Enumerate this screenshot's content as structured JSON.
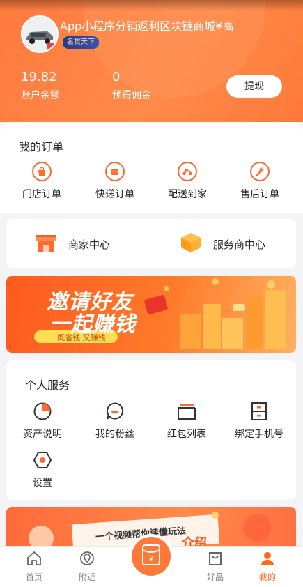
{
  "header": {
    "username": "App小程序分销返利区块链商城¥高",
    "badge": "名贯天下",
    "stats": [
      {
        "value": "19.82",
        "label": "账户余额"
      },
      {
        "value": "0",
        "label": "预得佣金"
      }
    ],
    "withdraw_label": "提现"
  },
  "orders": {
    "title": "我的订单",
    "items": [
      {
        "label": "门店订单",
        "icon": "shopping-bag-icon"
      },
      {
        "label": "快递订单",
        "icon": "package-icon"
      },
      {
        "label": "配送到家",
        "icon": "scooter-icon"
      },
      {
        "label": "售后订单",
        "icon": "wrench-icon"
      }
    ]
  },
  "centers": [
    {
      "label": "商家中心",
      "icon": "storefront-icon"
    },
    {
      "label": "服务商中心",
      "icon": "box-3d-icon"
    }
  ],
  "invite_banner": {
    "line1": "邀请好友",
    "line2": "一起赚钱",
    "tag": "既省钱 又赚钱"
  },
  "services": {
    "title": "个人服务",
    "items": [
      {
        "label": "资产说明",
        "icon": "pie-chart-icon"
      },
      {
        "label": "我的粉丝",
        "icon": "smile-chat-icon"
      },
      {
        "label": "红包列表",
        "icon": "red-packet-icon"
      },
      {
        "label": "绑定手机号",
        "icon": "cabinet-icon"
      },
      {
        "label": "设置",
        "icon": "settings-hexagon-icon"
      }
    ]
  },
  "bottom_banner": {
    "text": "一个视频帮你读懂玩法",
    "tail": "介绍"
  },
  "tabbar": {
    "items": [
      {
        "label": "首页",
        "icon": "home-icon"
      },
      {
        "label": "附近",
        "icon": "location-icon"
      },
      {
        "label": "好品",
        "icon": "shopping-bag-outline-icon"
      },
      {
        "label": "我的",
        "icon": "user-icon"
      }
    ],
    "center_icon": "yuan-wallet-icon",
    "active": "我的"
  },
  "colors": {
    "accent": "#ff6a33",
    "header": "#ff8446",
    "active_tab": "#ff6a1a"
  }
}
